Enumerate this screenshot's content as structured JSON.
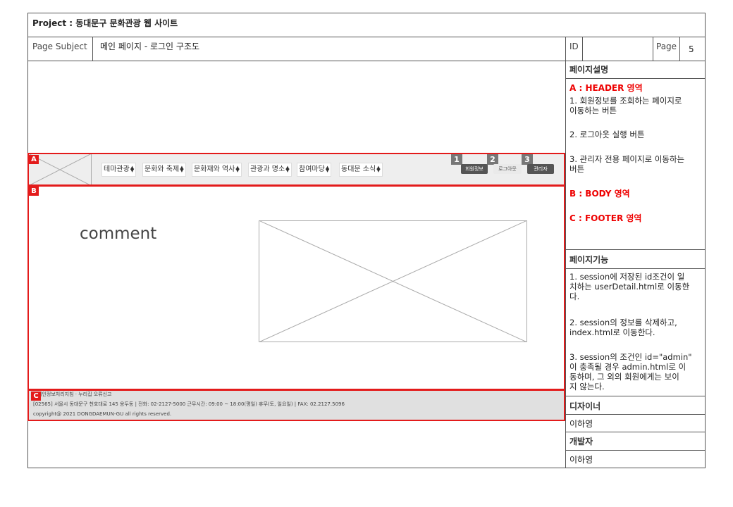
{
  "header": {
    "project_label": "Project : 동대문구 문화관광 웹 사이트",
    "subject_label": "Page Subject",
    "subject_value": "메인 페이지 - 로그인 구조도",
    "id_label": "ID",
    "id_value": "",
    "page_label": "Page",
    "page_value": "5"
  },
  "wireframe": {
    "regions": [
      "A",
      "B",
      "C"
    ],
    "nav_items": [
      "테마관광",
      "문화와 축제",
      "문화재와 역사",
      "관광과 명소",
      "참여마당",
      "동대문 소식"
    ],
    "buttons": [
      {
        "num": "1",
        "label": "회원정보"
      },
      {
        "num": "2",
        "label": "로그아웃"
      },
      {
        "num": "3",
        "label": "관리자"
      }
    ],
    "body_comment": "comment",
    "footer": {
      "line1": "개인정보처리지침  ·  누리집 오류신고",
      "line2": "[02565] 서울시 동대문구 천호대로 145 용두동 | 전화: 02-2127-5000 근무시간: 09:00 ~ 18:00(평일) 휴무(토, 일요일) | FAX: 02.2127.5096",
      "line3": "copyright@ 2021 DONGDAEMUN-GU all rights reserved."
    }
  },
  "sidebar": {
    "desc_title": "페이지설명",
    "a_title": "A : HEADER 영역",
    "a_items": [
      "1. 회원정보를 조회하는 페이지로\n이동하는 버튼",
      "2. 로그아웃 실행 버튼",
      "3. 관리자 전용 페이지로 이동하는\n버튼"
    ],
    "b_title": "B : BODY 영역",
    "c_title": "C : FOOTER 영역",
    "func_title": "페이지기능",
    "func_items": [
      "1. session에 저장된 id조건이 일\n치하는 userDetail.html로 이동한\n다.",
      "2. session의 정보를 삭제하고,\nindex.html로 이동한다.",
      "3. session의 조건인 id=\"admin\"\n이 충족될 경우 admin.html로 이\n동하며, 그 외의 회원에게는 보이\n지 않는다."
    ],
    "designer_label": "디자이너",
    "designer_name": "이하영",
    "developer_label": "개발자",
    "developer_name": "이하영"
  },
  "colors": {
    "accent_red": "#e31b1b",
    "tag_gray": "#777777",
    "footer_bg": "#e0e0e0",
    "nav_bg": "#eeeeee"
  }
}
